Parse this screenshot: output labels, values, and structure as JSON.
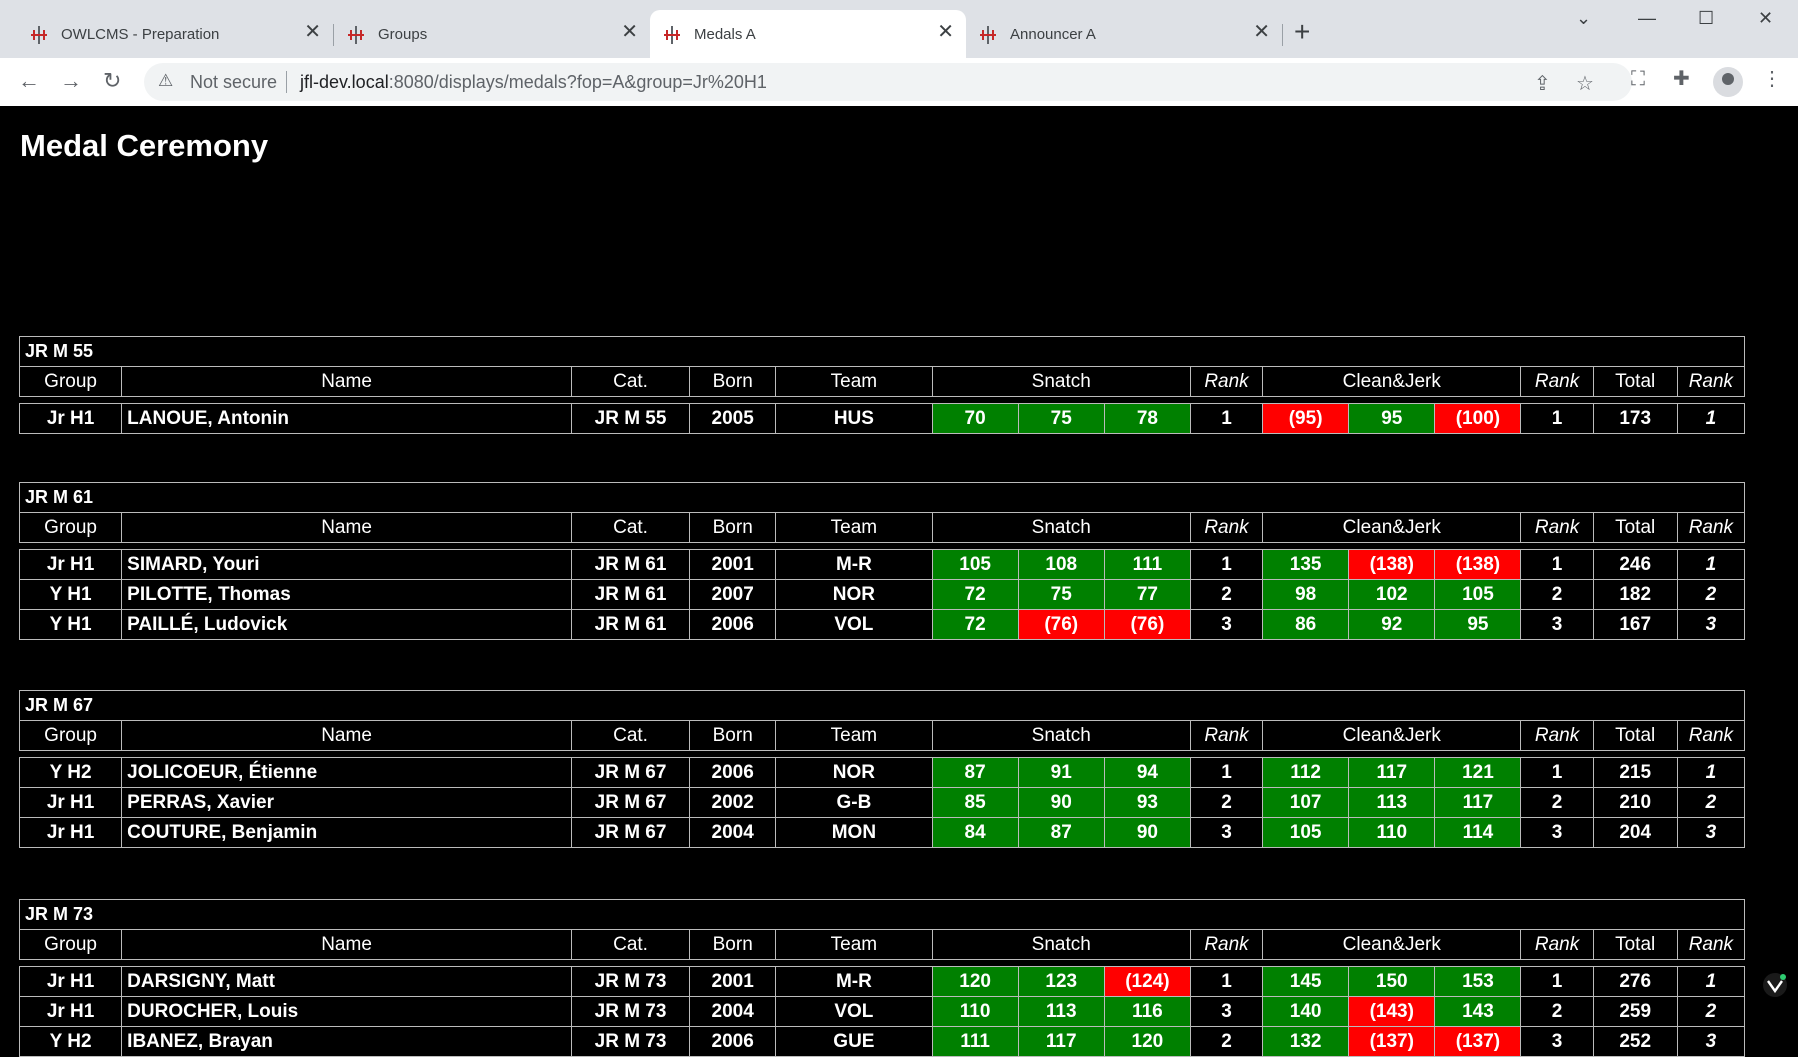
{
  "browser": {
    "tabs": [
      {
        "label": "OWLCMS - Preparation"
      },
      {
        "label": "Groups"
      },
      {
        "label": "Medals A"
      },
      {
        "label": "Announcer A"
      }
    ],
    "new_tab_symbol": "+",
    "security_text": "Not secure",
    "url_host": "jfl-dev.local",
    "url_rest": ":8080/displays/medals?fop=A&group=Jr%20H1"
  },
  "page": {
    "title": "Medal Ceremony",
    "headers": {
      "group": "Group",
      "name": "Name",
      "cat": "Cat.",
      "born": "Born",
      "team": "Team",
      "snatch": "Snatch",
      "rank": "Rank",
      "cj": "Clean&Jerk",
      "total": "Total"
    },
    "categories": [
      {
        "name": "JR M 55",
        "rows": [
          {
            "group": "Jr H1",
            "name": "LANOUE, Antonin",
            "cat": "JR M 55",
            "born": "2005",
            "team": "HUS",
            "sn": [
              [
                "70",
                "good"
              ],
              [
                "75",
                "good"
              ],
              [
                "78",
                "good"
              ]
            ],
            "sn_rank": "1",
            "cj": [
              [
                "(95)",
                "bad"
              ],
              [
                "95",
                "good"
              ],
              [
                "(100)",
                "bad"
              ]
            ],
            "cj_rank": "1",
            "total": "173",
            "total_rank": "1"
          }
        ]
      },
      {
        "name": "JR M 61",
        "rows": [
          {
            "group": "Jr H1",
            "name": "SIMARD, Youri",
            "cat": "JR M 61",
            "born": "2001",
            "team": "M-R",
            "sn": [
              [
                "105",
                "good"
              ],
              [
                "108",
                "good"
              ],
              [
                "111",
                "good"
              ]
            ],
            "sn_rank": "1",
            "cj": [
              [
                "135",
                "good"
              ],
              [
                "(138)",
                "bad"
              ],
              [
                "(138)",
                "bad"
              ]
            ],
            "cj_rank": "1",
            "total": "246",
            "total_rank": "1"
          },
          {
            "group": "Y H1",
            "name": "PILOTTE, Thomas",
            "cat": "JR M 61",
            "born": "2007",
            "team": "NOR",
            "sn": [
              [
                "72",
                "good"
              ],
              [
                "75",
                "good"
              ],
              [
                "77",
                "good"
              ]
            ],
            "sn_rank": "2",
            "cj": [
              [
                "98",
                "good"
              ],
              [
                "102",
                "good"
              ],
              [
                "105",
                "good"
              ]
            ],
            "cj_rank": "2",
            "total": "182",
            "total_rank": "2"
          },
          {
            "group": "Y H1",
            "name": "PAILLÉ, Ludovick",
            "cat": "JR M 61",
            "born": "2006",
            "team": "VOL",
            "sn": [
              [
                "72",
                "good"
              ],
              [
                "(76)",
                "bad"
              ],
              [
                "(76)",
                "bad"
              ]
            ],
            "sn_rank": "3",
            "cj": [
              [
                "86",
                "good"
              ],
              [
                "92",
                "good"
              ],
              [
                "95",
                "good"
              ]
            ],
            "cj_rank": "3",
            "total": "167",
            "total_rank": "3"
          }
        ]
      },
      {
        "name": "JR M 67",
        "rows": [
          {
            "group": "Y H2",
            "name": "JOLICOEUR, Étienne",
            "cat": "JR M 67",
            "born": "2006",
            "team": "NOR",
            "sn": [
              [
                "87",
                "good"
              ],
              [
                "91",
                "good"
              ],
              [
                "94",
                "good"
              ]
            ],
            "sn_rank": "1",
            "cj": [
              [
                "112",
                "good"
              ],
              [
                "117",
                "good"
              ],
              [
                "121",
                "good"
              ]
            ],
            "cj_rank": "1",
            "total": "215",
            "total_rank": "1"
          },
          {
            "group": "Jr H1",
            "name": "PERRAS, Xavier",
            "cat": "JR M 67",
            "born": "2002",
            "team": "G-B",
            "sn": [
              [
                "85",
                "good"
              ],
              [
                "90",
                "good"
              ],
              [
                "93",
                "good"
              ]
            ],
            "sn_rank": "2",
            "cj": [
              [
                "107",
                "good"
              ],
              [
                "113",
                "good"
              ],
              [
                "117",
                "good"
              ]
            ],
            "cj_rank": "2",
            "total": "210",
            "total_rank": "2"
          },
          {
            "group": "Jr H1",
            "name": "COUTURE, Benjamin",
            "cat": "JR M 67",
            "born": "2004",
            "team": "MON",
            "sn": [
              [
                "84",
                "good"
              ],
              [
                "87",
                "good"
              ],
              [
                "90",
                "good"
              ]
            ],
            "sn_rank": "3",
            "cj": [
              [
                "105",
                "good"
              ],
              [
                "110",
                "good"
              ],
              [
                "114",
                "good"
              ]
            ],
            "cj_rank": "3",
            "total": "204",
            "total_rank": "3"
          }
        ]
      },
      {
        "name": "JR M 73",
        "rows": [
          {
            "group": "Jr H1",
            "name": "DARSIGNY, Matt",
            "cat": "JR M 73",
            "born": "2001",
            "team": "M-R",
            "sn": [
              [
                "120",
                "good"
              ],
              [
                "123",
                "good"
              ],
              [
                "(124)",
                "bad"
              ]
            ],
            "sn_rank": "1",
            "cj": [
              [
                "145",
                "good"
              ],
              [
                "150",
                "good"
              ],
              [
                "153",
                "good"
              ]
            ],
            "cj_rank": "1",
            "total": "276",
            "total_rank": "1"
          },
          {
            "group": "Jr H1",
            "name": "DUROCHER, Louis",
            "cat": "JR M 73",
            "born": "2004",
            "team": "VOL",
            "sn": [
              [
                "110",
                "good"
              ],
              [
                "113",
                "good"
              ],
              [
                "116",
                "good"
              ]
            ],
            "sn_rank": "3",
            "cj": [
              [
                "140",
                "good"
              ],
              [
                "(143)",
                "bad"
              ],
              [
                "143",
                "good"
              ]
            ],
            "cj_rank": "2",
            "total": "259",
            "total_rank": "2"
          },
          {
            "group": "Y H2",
            "name": "IBANEZ, Brayan",
            "cat": "JR M 73",
            "born": "2006",
            "team": "GUE",
            "sn": [
              [
                "111",
                "good"
              ],
              [
                "117",
                "good"
              ],
              [
                "120",
                "good"
              ]
            ],
            "sn_rank": "2",
            "cj": [
              [
                "132",
                "good"
              ],
              [
                "(137)",
                "bad"
              ],
              [
                "(137)",
                "bad"
              ]
            ],
            "cj_rank": "3",
            "total": "252",
            "total_rank": "3"
          }
        ]
      }
    ],
    "colors": {
      "good": "#008000",
      "bad": "#ff0000",
      "background": "#000000",
      "text": "#ffffff"
    }
  }
}
